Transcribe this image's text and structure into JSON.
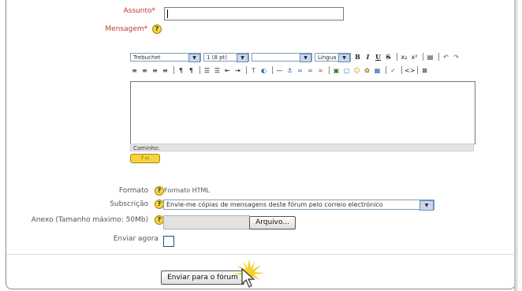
{
  "form": {
    "subject_label": "Assunto",
    "message_label": "Mensagem",
    "required_mark": "*",
    "help_mark": "?",
    "format_label": "Formato",
    "format_value": "Formato HTML",
    "subscription_label": "Subscrição",
    "subscription_value": "Envie-me cópias de mensagens deste fórum pelo correio electrónico",
    "attachment_label": "Anexo (Tamanho máximo: 50Mb)",
    "browse_button": "Arquivo...",
    "send_now_label": "Enviar agora",
    "submit_button": "Enviar para o fórum"
  },
  "editor": {
    "font_value": "Trebuchet",
    "size_value": "1 (8 pt)",
    "style_value": "",
    "language_value": "Língua",
    "path_label": "Caminho:",
    "help_button": "?",
    "row1_buttons": [
      "B",
      "I",
      "U",
      "S",
      "x₂",
      "x²",
      "▤",
      "↶",
      "↷"
    ],
    "row2_buttons": [
      "≡",
      "≡",
      "≡",
      "≡",
      "¶",
      "¶",
      "☰",
      "☰",
      "⇤",
      "⇥",
      "T",
      "◐",
      "—",
      "⚓",
      "∞",
      "∞",
      "∞",
      "▣",
      "▢",
      "☺",
      "✿",
      "▦",
      "✓",
      "<>",
      "⊠"
    ]
  }
}
